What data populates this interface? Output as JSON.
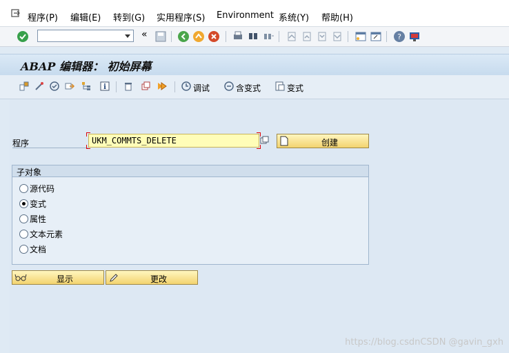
{
  "menu": {
    "items": [
      "程序(P)",
      "编辑(E)",
      "转到(G)",
      "实用程序(S)",
      "Environment",
      "系统(Y)",
      "帮助(H)"
    ]
  },
  "toolbar": {
    "command_value": "",
    "icons": [
      "check-icon",
      "dropdown-arrow-icon",
      "double-left-icon",
      "save-icon",
      "back-icon",
      "exit-icon",
      "cancel-icon",
      "print-icon",
      "find-icon",
      "find-next-icon",
      "first-page-icon",
      "prev-page-icon",
      "next-page-icon",
      "last-page-icon",
      "new-session-icon",
      "shortcut-icon",
      "help-icon",
      "customize-layout-icon"
    ]
  },
  "screen": {
    "title": "ABAP 编辑器： 初始屏幕"
  },
  "app_toolbar": {
    "debug_label": "调试",
    "with_variant_label": "含变式",
    "variant_label": "变式"
  },
  "program": {
    "label": "程序",
    "value": "UKM_COMMTS_DELETE",
    "create_label": "创建"
  },
  "subobjects": {
    "title": "子对象",
    "options": [
      {
        "label": "源代码",
        "selected": false
      },
      {
        "label": "变式",
        "selected": true
      },
      {
        "label": "属性",
        "selected": false
      },
      {
        "label": "文本元素",
        "selected": false
      },
      {
        "label": "文档",
        "selected": false
      }
    ]
  },
  "actions": {
    "display_label": "显示",
    "change_label": "更改"
  },
  "watermark": "https://blog.csdnCSDN @gavin_gxh"
}
